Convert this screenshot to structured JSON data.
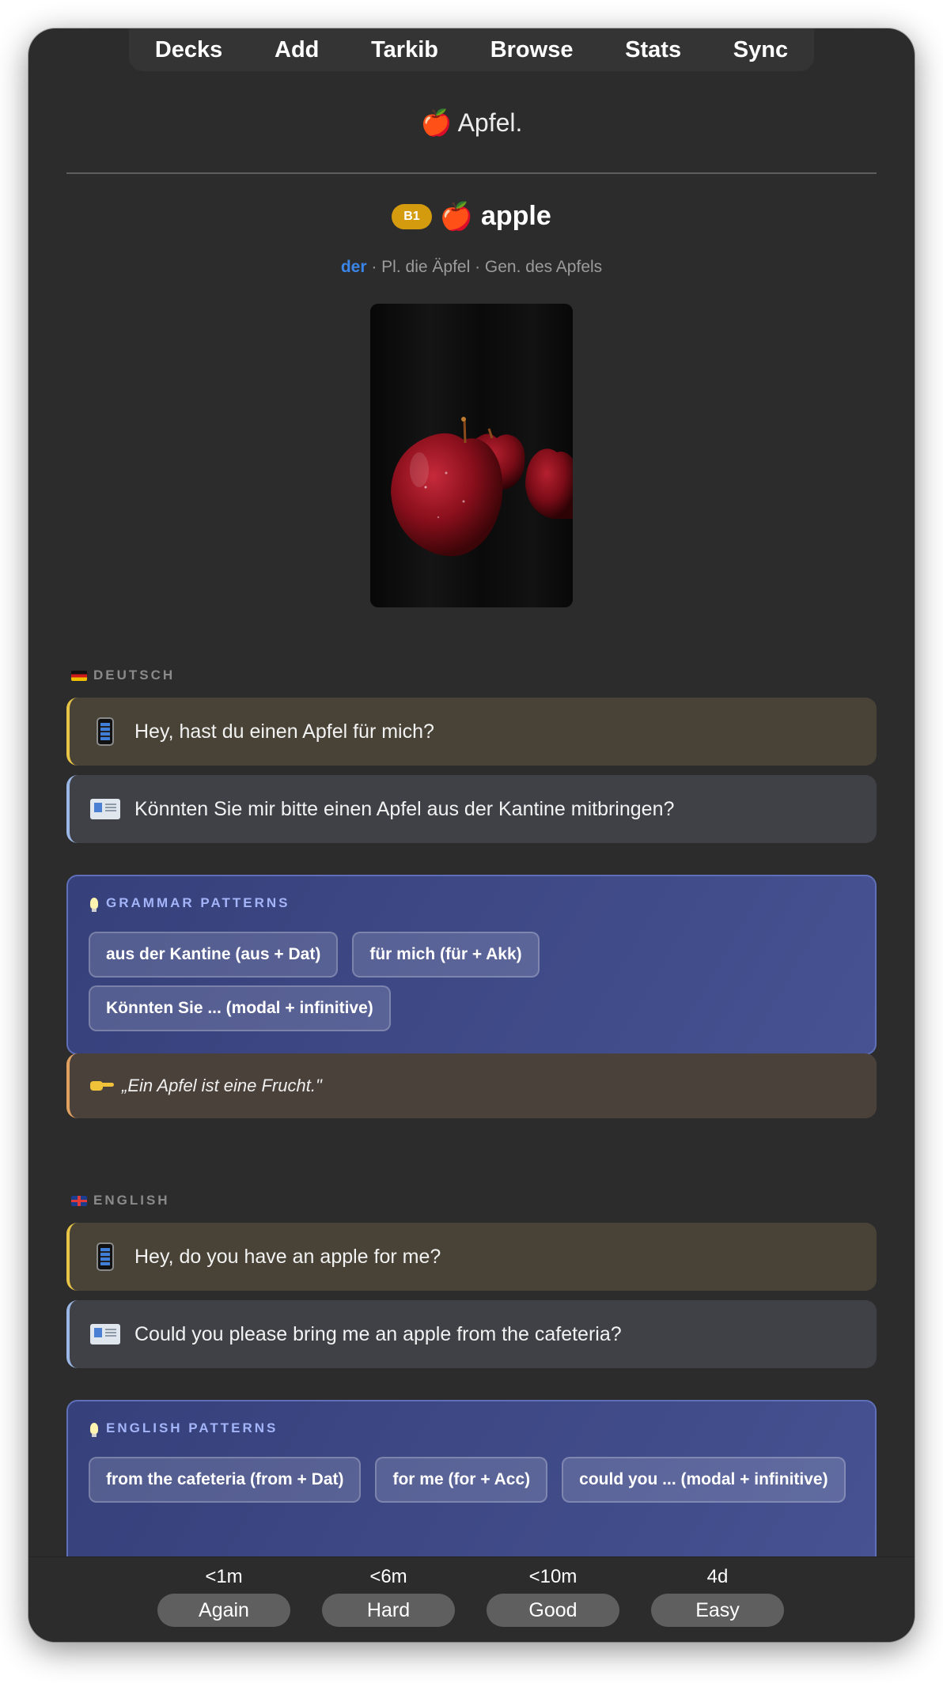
{
  "nav": {
    "items": [
      "Decks",
      "Add",
      "Tarkib",
      "Browse",
      "Stats",
      "Sync"
    ]
  },
  "front": {
    "emoji": "🍎",
    "title": "Apfel."
  },
  "back": {
    "level": "B1",
    "emoji": "🍎",
    "word": "apple",
    "article": "der",
    "inflection": " · Pl. die Äpfel · Gen. des Apfels"
  },
  "deutsch": {
    "label": "DEUTSCH",
    "casual": "Hey, hast du einen Apfel für mich?",
    "formal": "Könnten Sie mir bitte einen Apfel aus der Kantine mitbringen?",
    "patterns_title": "GRAMMAR PATTERNS",
    "patterns": [
      "aus der Kantine (aus + Dat)",
      "für mich (für + Akk)",
      "Könnten Sie ... (modal + infinitive)"
    ],
    "example": "„Ein Apfel ist eine Frucht.\""
  },
  "english": {
    "label": "ENGLISH",
    "casual": "Hey, do you have an apple for me?",
    "formal": "Could you please bring me an apple from the cafeteria?",
    "patterns_title": "ENGLISH PATTERNS",
    "patterns": [
      "from the cafeteria (from + Dat)",
      "for me (for + Acc)",
      "could you ... (modal + infinitive)"
    ]
  },
  "answers": [
    {
      "interval": "<1m",
      "label": "Again"
    },
    {
      "interval": "<6m",
      "label": "Hard"
    },
    {
      "interval": "<10m",
      "label": "Good"
    },
    {
      "interval": "4d",
      "label": "Easy"
    }
  ],
  "colors": {
    "background": "#2c2c2c",
    "level_badge": "#d49b0f",
    "article": "#3a86e8",
    "casual_accent": "#e8c547",
    "formal_accent": "#9bb7e6",
    "patterns_bg": "#3e4a8a",
    "patterns_title": "#a4b4f8",
    "example_accent": "#e0a060"
  },
  "icons": {
    "casual": "mobile-phone-icon",
    "formal": "envelope-icon",
    "patterns": "light-bulb-icon",
    "example": "pointing-hand-icon",
    "flag_de": "german-flag-icon",
    "flag_en": "uk-flag-icon"
  }
}
